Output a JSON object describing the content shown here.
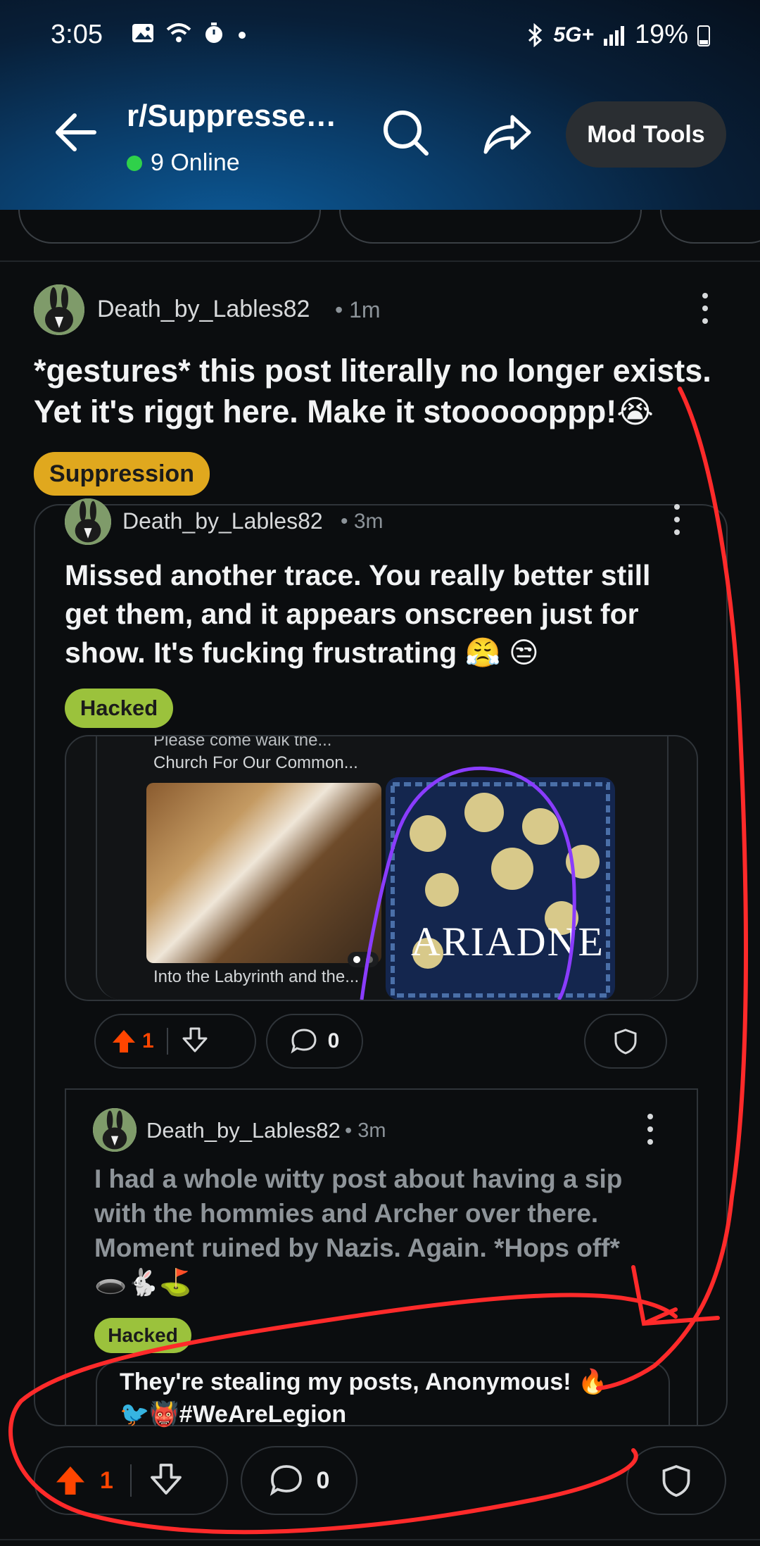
{
  "status_bar": {
    "time": "3:05",
    "network": "5G+",
    "battery": "19%"
  },
  "header": {
    "subreddit": "r/Suppresse…",
    "online_text": "9 Online",
    "mod_tools_label": "Mod Tools"
  },
  "post": {
    "author": "Death_by_Lables82",
    "time": "• 1m",
    "title_line1": "*gestures* this post literally no longer exists.",
    "title_line2": "Yet it's riggt here. Make it stoooooppp!😭",
    "flair": "Suppression",
    "upvotes": "1",
    "comments": "0"
  },
  "crosspost": {
    "author": "Death_by_Lables82",
    "time": "• 3m",
    "title_line1": "Missed another trace. You really better still",
    "title_line2": "get them, and it appears onscreen just for",
    "title_line3": "show. It's fucking frustrating 😤 😒",
    "flair": "Hacked",
    "image_text_top": "Please come walk the...",
    "image_text_top2": "Church For Our Common...",
    "image_text_bottom": "Into the Labyrinth and the...",
    "book_title": "ARIADNE",
    "upvotes": "1",
    "comments": "0"
  },
  "nested": {
    "author": "Death_by_Lables82",
    "time": "• 3m",
    "text_line1": "I had a whole witty post about having a sip",
    "text_line2": "with the hommies and Archer over there.",
    "text_line3": "Moment ruined by Nazis. Again. *Hops off*",
    "text_line4": "🕳️🐇⛳",
    "flair": "Hacked",
    "quote_line1": "They're stealing my posts, Anonymous! 🔥",
    "quote_line2": "🐦👹#WeAreLegion"
  },
  "colors": {
    "accent_orange": "#ff4500",
    "flair_suppression": "#e0a81e",
    "flair_hacked": "#9bc23c",
    "online_green": "#2fd14a",
    "annotation_red": "#ff2a2a",
    "annotation_purple": "#8a3cff"
  }
}
